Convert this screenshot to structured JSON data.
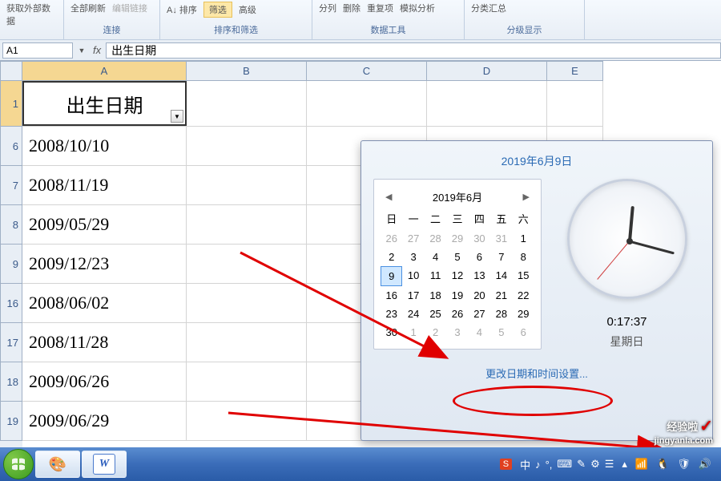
{
  "ribbon": {
    "groups": [
      {
        "top": [
          "获取外部数据"
        ],
        "label": ""
      },
      {
        "top": [
          "全部刷新",
          "编辑链接"
        ],
        "label": "连接"
      },
      {
        "top": [
          "排序",
          "筛选",
          "高级"
        ],
        "label": "排序和筛选"
      },
      {
        "top": [
          "分列",
          "删除",
          "重复项",
          "模拟分析"
        ],
        "label": "数据工具"
      },
      {
        "top": [
          "分类汇总"
        ],
        "label": "分级显示"
      }
    ]
  },
  "nameBox": "A1",
  "fx": "fx",
  "formulaValue": "出生日期",
  "columns": [
    "A",
    "B",
    "C",
    "D",
    "E"
  ],
  "rows": [
    1,
    6,
    7,
    8,
    9,
    16,
    17,
    18,
    19
  ],
  "headerCell": "出生日期",
  "data": [
    "2008/10/10",
    "2008/11/19",
    "2009/05/29",
    "2009/12/23",
    "2008/06/02",
    "2008/11/28",
    "2009/06/26",
    "2009/06/29"
  ],
  "popup": {
    "title": "2019年6月9日",
    "monthYear": "2019年6月",
    "weekdays": [
      "日",
      "一",
      "二",
      "三",
      "四",
      "五",
      "六"
    ],
    "prevDays": [
      26,
      27,
      28,
      29,
      30,
      31
    ],
    "days": [
      1,
      2,
      3,
      4,
      5,
      6,
      7,
      8,
      9,
      10,
      11,
      12,
      13,
      14,
      15,
      16,
      17,
      18,
      19,
      20,
      21,
      22,
      23,
      24,
      25,
      26,
      27,
      28,
      29,
      30
    ],
    "nextDays": [
      1,
      2,
      3,
      4,
      5,
      6
    ],
    "currentDay": 9,
    "time": "0:17:37",
    "dayOfWeek": "星期日",
    "changeLink": "更改日期和时间设置..."
  },
  "taskbar": {
    "wordLabel": "W",
    "sogouLabel": "S",
    "lang": "中"
  },
  "watermark": {
    "text": "经验啦",
    "url": "jingyanla.com"
  }
}
